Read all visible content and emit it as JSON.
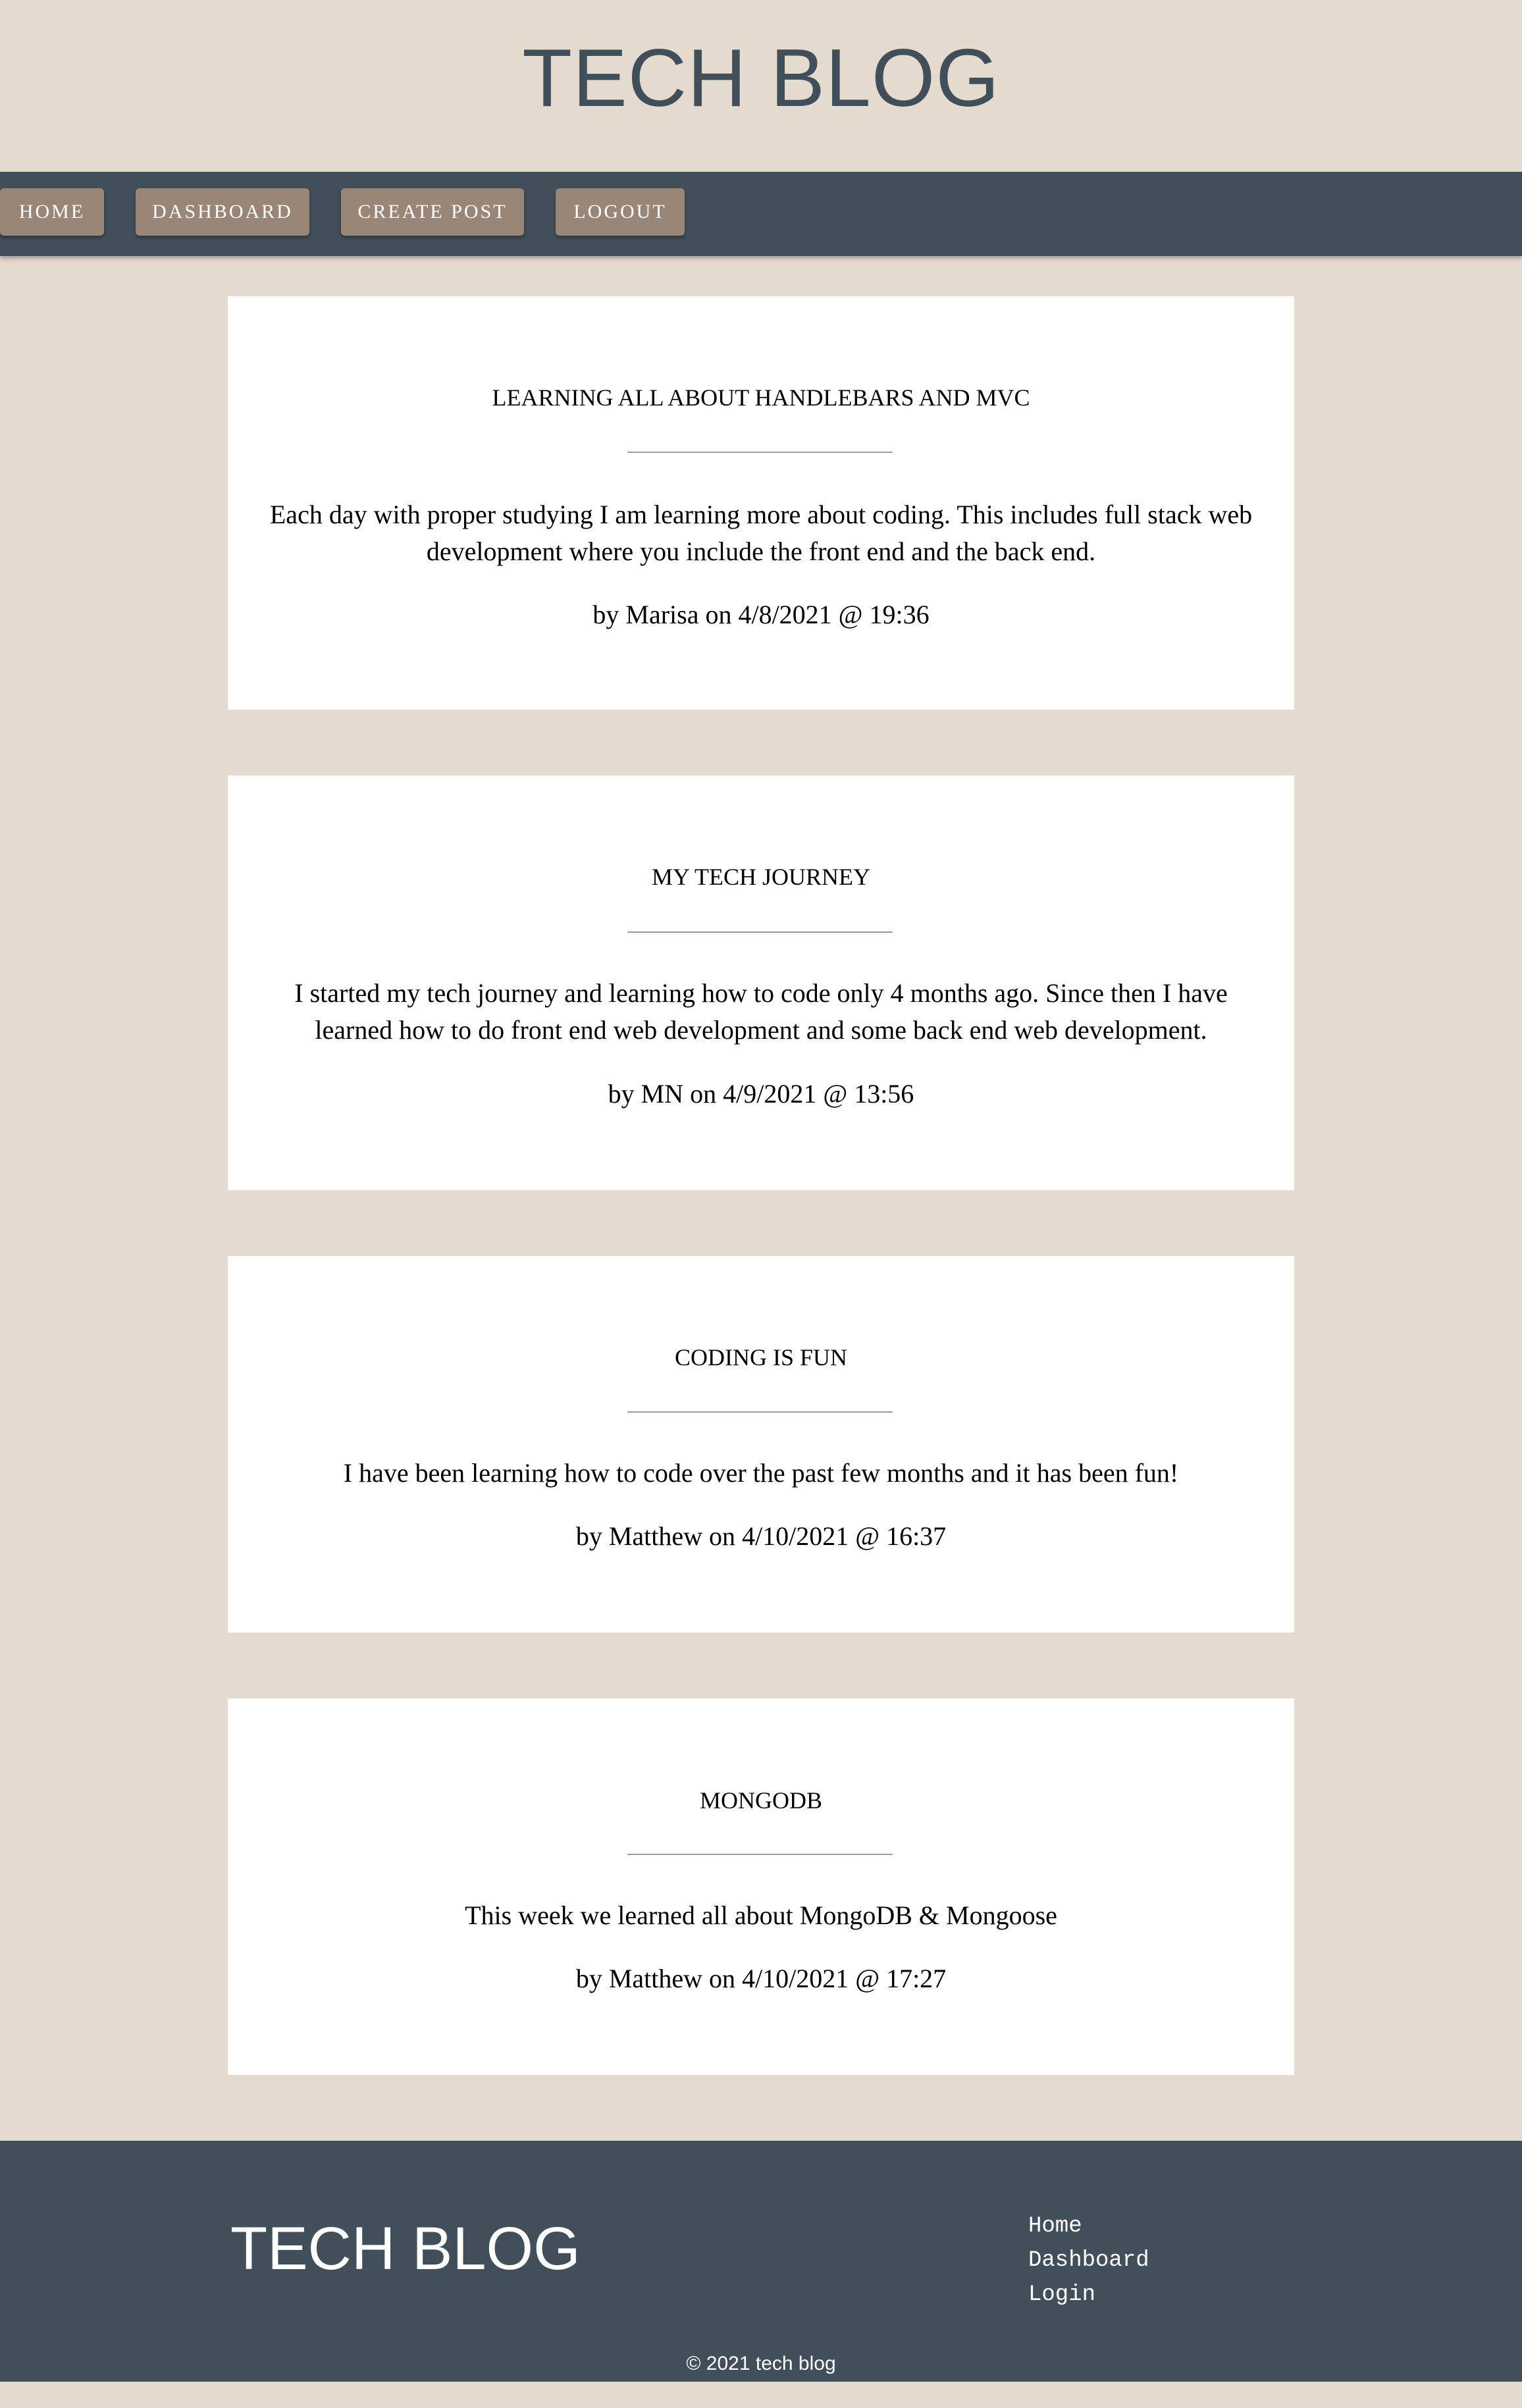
{
  "header": {
    "title": "TECH BLOG"
  },
  "nav": {
    "items": [
      {
        "label": "HOME"
      },
      {
        "label": "DASHBOARD"
      },
      {
        "label": "CREATE POST"
      },
      {
        "label": "LOGOUT"
      }
    ]
  },
  "posts": [
    {
      "title": "LEARNING ALL ABOUT HANDLEBARS AND MVC",
      "body": "Each day with proper studying I am learning more about coding. This includes full stack web development where you include the front end and the back end.",
      "meta": "by Marisa on 4/8/2021 @ 19:36"
    },
    {
      "title": "MY TECH JOURNEY",
      "body": "I started my tech journey and learning how to code only 4 months ago. Since then I have learned how to do front end web development and some back end web development.",
      "meta": "by MN on 4/9/2021 @ 13:56"
    },
    {
      "title": "CODING IS FUN",
      "body": "I have been learning how to code over the past few months and it has been fun!",
      "meta": "by Matthew on 4/10/2021 @ 16:37"
    },
    {
      "title": "MONGODB",
      "body": "This week we learned all about MongoDB & Mongoose",
      "meta": "by Matthew on 4/10/2021 @ 17:27"
    }
  ],
  "footer": {
    "title": "TECH BLOG",
    "links": [
      {
        "label": "Home"
      },
      {
        "label": "Dashboard"
      },
      {
        "label": "Login"
      }
    ],
    "copyright": "© 2021 tech blog"
  },
  "colors": {
    "page_background": "#e4dacd",
    "nav_background": "#414f5b",
    "nav_button": "#9a8676",
    "card_background": "#ffffff",
    "title_color": "#414f5b"
  }
}
